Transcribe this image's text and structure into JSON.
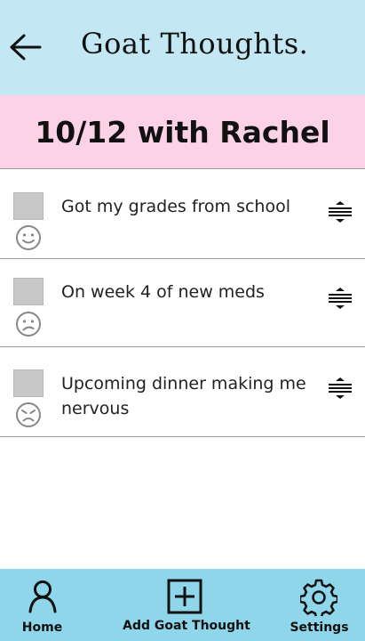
{
  "header": {
    "title": "Goat Thoughts.",
    "back_icon": "arrow-left-icon"
  },
  "session": {
    "title": "10/12 with Rachel"
  },
  "thoughts": [
    {
      "text": "Got my grades from school",
      "mood": "happy-face-icon",
      "checked": false
    },
    {
      "text": "On week 4 of new meds",
      "mood": "sad-face-icon",
      "checked": false
    },
    {
      "text": "Upcoming dinner making me nervous",
      "mood": "angry-face-icon",
      "checked": false
    }
  ],
  "nav": {
    "home_label": "Home",
    "add_label": "Add Goat Thought",
    "settings_label": "Settings"
  },
  "colors": {
    "header_bg": "#c3e8f3",
    "banner_bg": "#fcd3e6",
    "nav_bg": "#8fd6ea"
  }
}
